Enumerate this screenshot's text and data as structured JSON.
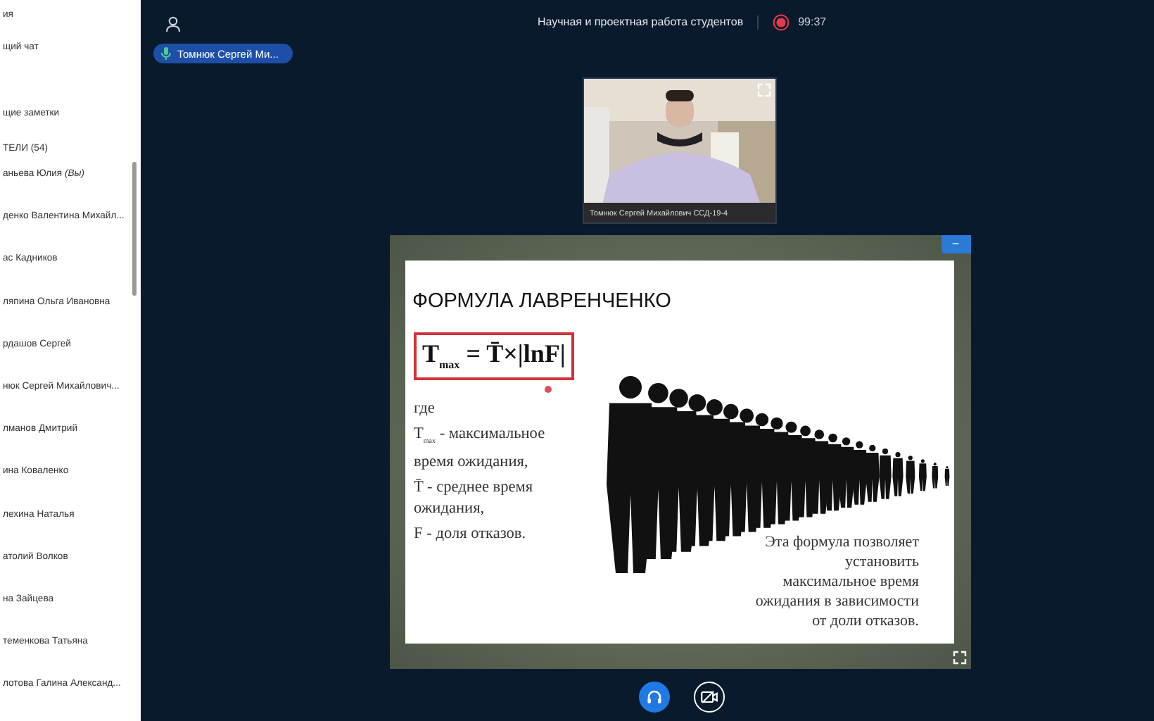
{
  "sidebar": {
    "header": "ия",
    "items": [
      {
        "label": "щий чат"
      },
      {
        "label": "щие заметки"
      }
    ],
    "participants_heading": "ТЕЛИ (54)",
    "participants": [
      {
        "name": "аньева Юлия *(Вы)*"
      },
      {
        "name": "денко Валентина Михайл..."
      },
      {
        "name": "ас Кадников"
      },
      {
        "name": "ляпина Ольга Ивановна"
      },
      {
        "name": "рдашов Сергей"
      },
      {
        "name": "нюк Сергей Михайлович..."
      },
      {
        "name": "лманов Дмитрий"
      },
      {
        "name": "ина Коваленко"
      },
      {
        "name": "лехина Наталья"
      },
      {
        "name": "атолий Волков"
      },
      {
        "name": "на Зайцева"
      },
      {
        "name": "теменкова Татьяна"
      },
      {
        "name": "лотова Галина Александ..."
      }
    ]
  },
  "header": {
    "title": "Научная и проектная работа студентов",
    "recording": true,
    "timer": "99:37"
  },
  "speaker": {
    "name": "Томнюк Сергей Ми..."
  },
  "video": {
    "caption": "Томнюк Сергей Михайлович ССД-19-4"
  },
  "slide": {
    "title": "ФОРМУЛА ЛАВРЕНЧЕНКО",
    "formula": "T$_{max}$ = T̄×|lnF|",
    "legend": [
      "где",
      "T$_{max}$ - максимальное время ожидания,",
      "T̄ - среднее время ожидания,",
      "F - доля отказов."
    ],
    "note": "Эта формула позволяет установить максимальное время ожидания в зависимости от доли отказов.",
    "minimize": "−"
  },
  "controls": {
    "audio_on": true
  }
}
